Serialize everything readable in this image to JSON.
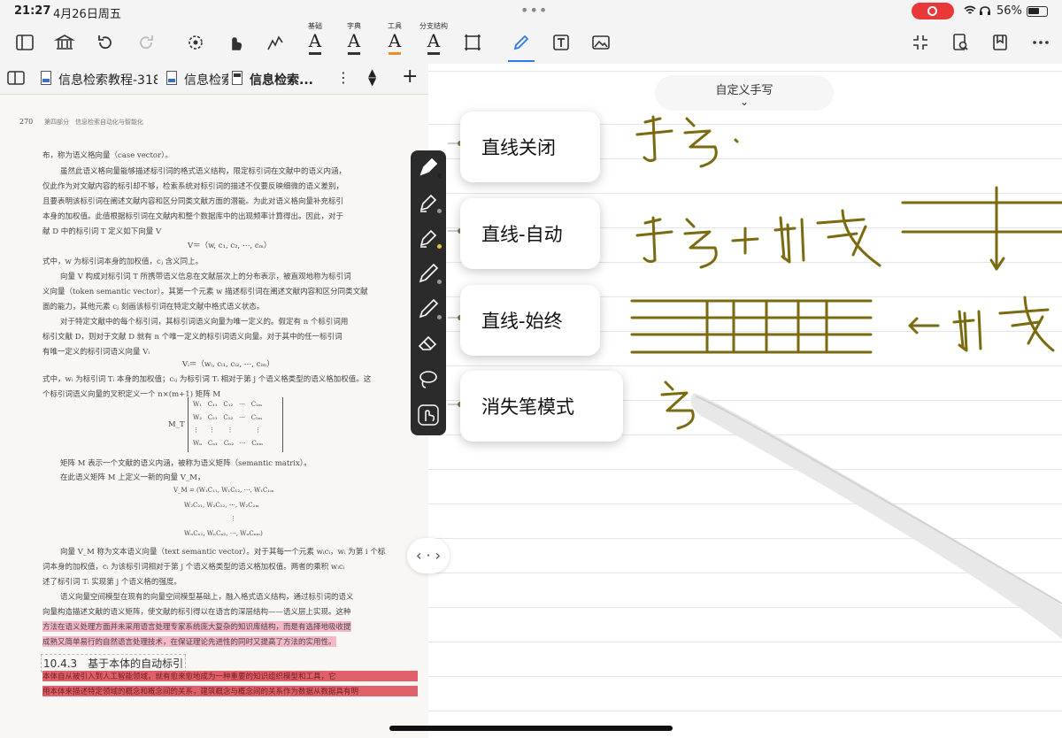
{
  "status": {
    "time": "21:27",
    "date": "4月26日周五",
    "battery": "56%"
  },
  "toolbar": {
    "labels": {
      "basic": "基础",
      "dict": "字典",
      "tools": "工具",
      "branch": "分支结构"
    },
    "accent": "#2b7bf2"
  },
  "tabs": [
    {
      "label": "信息检索教程-318p"
    },
    {
      "label": "信息检索"
    },
    {
      "label": "信息检索..."
    }
  ],
  "doc": {
    "page_no": "270",
    "running_head": "第四部分　信息检索自动化与智能化",
    "lines": [
      "布，称为语义格向量（case vector）。",
      "虽然此语义格向量能够描述标引词的格式语义结构，限定标引词在文献中的语义内涵，",
      "仅此作为对文献内容的标引却不够，检索系统对标引词的描述不仅要反映细微的语义差别，",
      "且要表明该标引词在阐述文献内容和区分同类文献方面的潜能。为此对语义格向量补充标引",
      "本身的加权值。此值根据标引词在文献内和整个数据库中的出现频率计算得出。因此，对于",
      "献 D 中的标引词 T 定义如下向量 V",
      "V＝（w, c₁, c₂, ⋯, cₘ）",
      "式中，w 为标引词本身的加权值，cⱼ 含义同上。",
      "向量 V 构成对标引词 T 所携带语义信息在文献层次上的分布表示，被直观地称为标引词",
      "义向量（token semantic vector）。其第一个元素 w 描述标引词在阐述文献内容和区分同类文献",
      "面的能力，其他元素 cⱼ 刻画该标引词在特定文献中格式语义状态。",
      "对于特定文献中的每个标引词，其标引词语义向量为唯一定义的。假定有 n 个标引词用",
      "标引文献 D，则对于文献 D 就有 n 个唯一定义的标引词语义向量。对于其中的任一标引词",
      "有唯一定义的标引词语义向量 Vᵢ",
      "Vᵢ＝（wᵢ, cᵢ₁, cᵢ₂, ⋯, cᵢₘ）",
      "式中，wᵢ 为标引词 Tᵢ 本身的加权值；cᵢⱼ 为标引词 Tᵢ 相对于第 j 个语义格类型的语义格加权值。这",
      "个标引词语义向量的叉积定义一个 n×(m+1) 矩阵 M",
      "矩阵 M 表示一个文献的语义内涵，被称为语义矩阵（semantic matrix）。",
      "在此语义矩阵 M 上定义一新的向量 V_M，",
      "向量 V_M 称为文本语义向量（text semantic vector）。对于其每一个元素 wᵢcᵢ，wᵢ 为第 i 个标",
      "词本身的加权值，cᵢ 为该标引词相对于第 j 个语义格类型的语义格加权值。两者的乘积 wᵢcᵢ",
      "述了标引词 Tᵢ 实现第 j 个语义格的强度。",
      "语义向量空间模型在现有的向量空间模型基础上，融入格式语义结构，通过标引词的语义",
      "向量构造描述文献的语义矩阵，使文献的标引得以在语言的深层结构——语义层上实现。这种",
      "方法在语义处理方面并未采用语言处理专家系统庞大复杂的知识库结构，而是有选择地吸收提",
      "成熟又简单易行的自然语言处理技术，在保证理论先进性的同时又提高了方法的实用性。",
      "本体自从被引入到人工智能领域，就有愈来愈地成为一种重要的知识组织模型和工具，它",
      "用本体来描述特定领域的概念和概念间的关系，建筑概念与概念间的关系作为数据从数据具有明"
    ],
    "matrix_label": "M_T",
    "matrix_rows": [
      [
        "W₁",
        "C₁₁",
        "C₁₂",
        "⋯",
        "C₁ₘ"
      ],
      [
        "W₂",
        "C₂₁",
        "C₂₂",
        "⋯",
        "C₂ₘ"
      ],
      [
        "⋮",
        "⋮",
        "⋮",
        "",
        "⋮"
      ],
      [
        "Wₙ",
        "Cₙ₁",
        "Cₙ₂",
        "⋯",
        "Cₙₘ"
      ]
    ],
    "vm_eq_1": "V_M = (W₁C₁₁, W₁C₁₂, ⋯, W₁C₁ₘ",
    "vm_eq_2": "W₂C₂₁, W₂C₂₂, ⋯, W₂C₂ₘ",
    "vm_eq_3": "⋮",
    "vm_eq_4": "WₙCₙ₁, WₙCₙ₂, ⋯, WₙCₙₘ)",
    "section_heading": "10.4.3　基于本体的自动标引"
  },
  "notes": {
    "custom_handwriting_label": "自定义手写",
    "callouts": [
      "直线关闭",
      "直线-自动",
      "直线-始终",
      "消失笔模式"
    ],
    "ink_color": "#7a6a10"
  },
  "penbar": {
    "dots": [
      "#222222",
      "#9a9a9a",
      "#e6c23a",
      "#9a9a9a",
      "#9a9a9a"
    ]
  },
  "right_panel": {
    "fab_label": "选择"
  },
  "nav": {
    "label": "‹ · ›"
  }
}
